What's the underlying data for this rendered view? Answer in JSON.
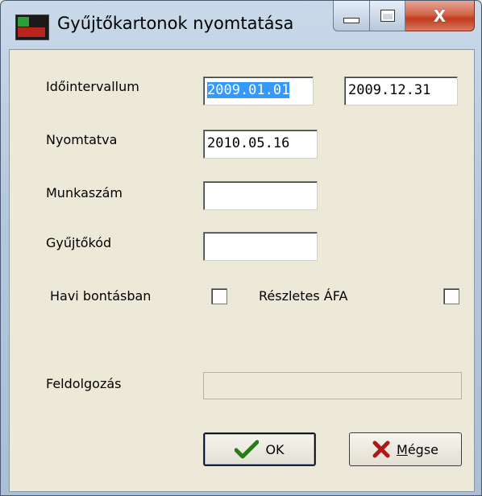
{
  "window": {
    "title": "Gyűjtőkartonok nyomtatása",
    "close_glyph": "X"
  },
  "form": {
    "interval_label": "Időintervallum",
    "interval_from": "2009.01.01",
    "interval_to": "2009.12.31",
    "printed_label": "Nyomtatva",
    "printed_value": "2010.05.16",
    "job_number_label": "Munkaszám",
    "job_number_value": "",
    "collector_code_label": "Gyűjtőkód",
    "collector_code_value": "",
    "monthly_label": "Havi bontásban",
    "detailed_vat_label": "Részletes ÁFA",
    "processing_label": "Feldolgozás"
  },
  "buttons": {
    "ok_label": "OK",
    "cancel_label": "Mégse",
    "cancel_accel": "M",
    "cancel_rest": "égse"
  },
  "colors": {
    "ok_check": "#2a7a1a",
    "cancel_x": "#b01818",
    "selection": "#3399ff"
  }
}
